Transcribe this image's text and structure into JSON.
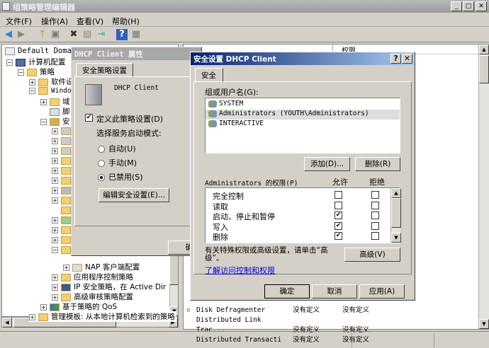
{
  "window": {
    "title": "组策略管理编辑器",
    "min": "_",
    "max": "□",
    "close": "✕"
  },
  "menu": [
    "文件(F)",
    "操作(A)",
    "查看(V)",
    "帮助(H)"
  ],
  "tree": {
    "items": [
      {
        "label": "Default Domain",
        "icon": "policy-icon"
      },
      {
        "label": "计算机配置",
        "icon": "computer-icon"
      },
      {
        "label": "策略",
        "icon": "folder-icon"
      },
      {
        "label": "软件设",
        "icon": "folder-icon"
      },
      {
        "label": "Windo",
        "icon": "folder-icon"
      },
      {
        "label": "域",
        "icon": "folder-icon"
      },
      {
        "label": "脚",
        "icon": "script-icon"
      },
      {
        "label": "安",
        "icon": "security-icon"
      },
      {
        "label": "NAP 客户端配置",
        "icon": "nap-icon"
      },
      {
        "label": "应用程序控制策略",
        "icon": "folder-icon"
      },
      {
        "label": "IP 安全策略，在 Active Dir",
        "icon": "ipsec-icon"
      },
      {
        "label": "高级审核策略配置",
        "icon": "folder-icon"
      },
      {
        "label": "基于策略的 QoS",
        "icon": "chart-icon"
      },
      {
        "label": "管理模板: 从本地计算机检索到的策略",
        "icon": "folder-icon"
      }
    ]
  },
  "right": {
    "column_header": "权限",
    "rows": [
      {
        "name": "Disk Defragmenter",
        "c1": "没有定义",
        "c2": "没有定义"
      },
      {
        "name": "Distributed Link Trac...",
        "c1": "没有定义",
        "c2": "没有定义"
      },
      {
        "name": "Distributed Transacti",
        "c1": "没有定义",
        "c2": "没有定义"
      }
    ]
  },
  "props": {
    "title": "DHCP Client 属性",
    "tab": "安全策略设置",
    "service": "DHCP Client",
    "define": "定义此策略设置(D)",
    "mode_label": "选择服务启动模式:",
    "modes": [
      "自动(U)",
      "手动(M)",
      "已禁用(S)"
    ],
    "selected_mode": 2,
    "edit_btn": "编辑安全设置(E)...",
    "ok": "确"
  },
  "sec": {
    "title": "安全设置 DHCP Client",
    "help": "?",
    "close": "✕",
    "tab": "安全",
    "users_label": "组或用户名(G):",
    "users": [
      "SYSTEM",
      "Administrators (YOUTH\\Administrators)",
      "INTERACTIVE"
    ],
    "add": "添加(D)...",
    "remove": "删除(R)",
    "perm_label": "Administrators 的权限(P)",
    "allow": "允许",
    "deny": "拒绝",
    "perms": [
      {
        "name": "完全控制",
        "allow": false,
        "deny": false
      },
      {
        "name": "读取",
        "allow": false,
        "deny": false
      },
      {
        "name": "启动、停止和暂停",
        "allow": true,
        "deny": false
      },
      {
        "name": "写入",
        "allow": true,
        "deny": false
      },
      {
        "name": "删除",
        "allow": true,
        "deny": false
      }
    ],
    "adv_text": "有关特殊权限或高级设置，请单击“高级”。",
    "advanced": "高级(V)",
    "link": "了解访问控制和权限",
    "ok": "确定",
    "cancel": "取消",
    "apply": "应用(A)"
  }
}
